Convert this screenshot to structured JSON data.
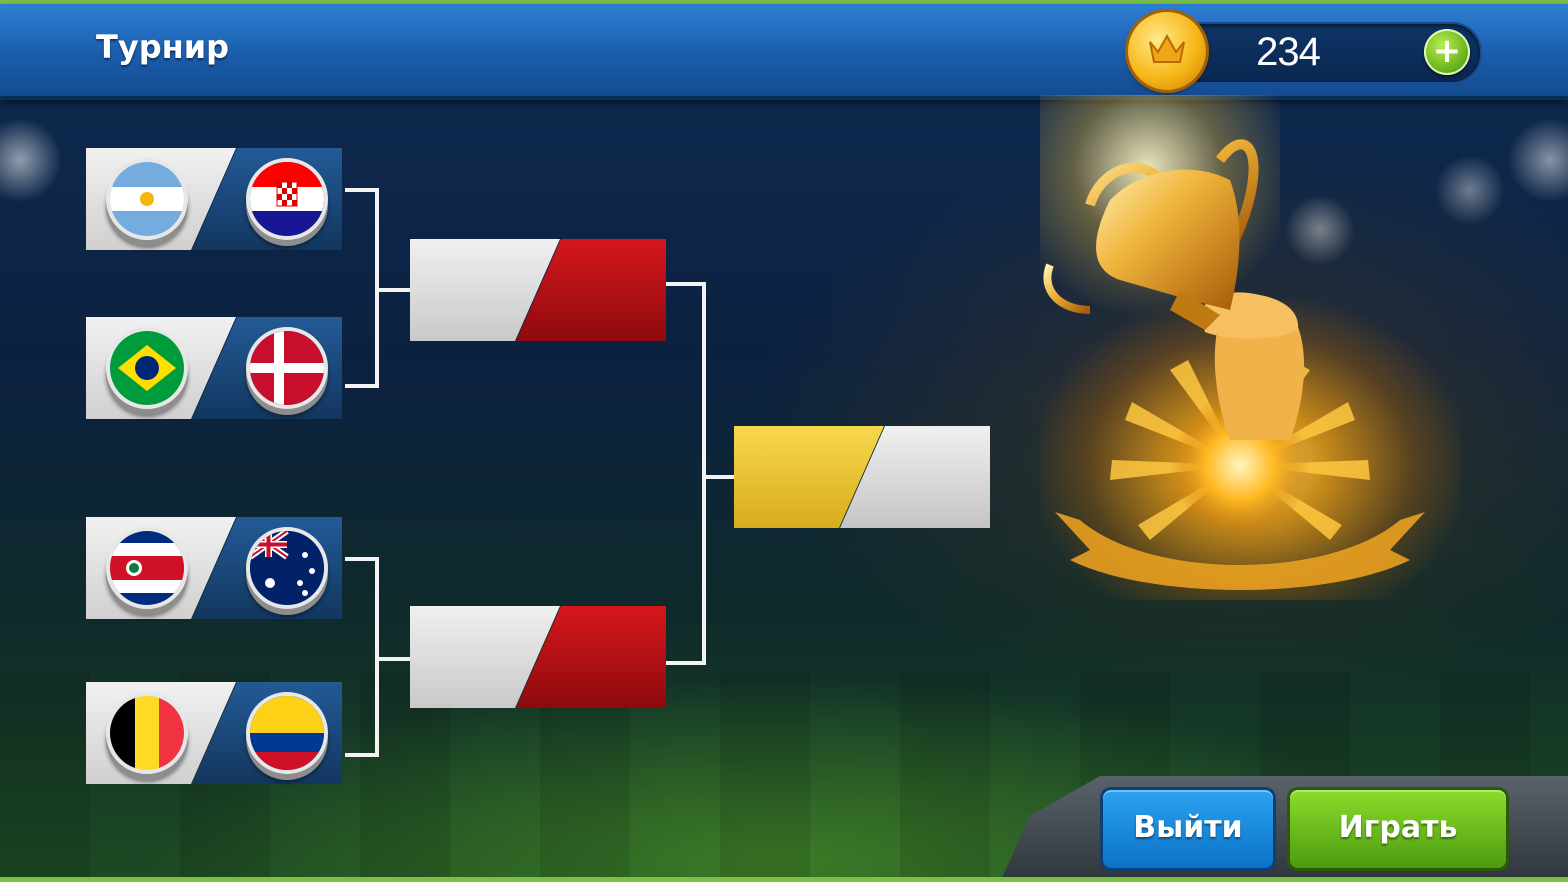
{
  "header": {
    "title": "Турнир",
    "coins": "234",
    "add_coins_icon": "plus-icon",
    "coin_icon": "crown-coin-icon"
  },
  "bracket": {
    "round1": [
      {
        "team1": "argentina-flag",
        "team2": "croatia-flag"
      },
      {
        "team1": "brazil-flag",
        "team2": "denmark-flag"
      },
      {
        "team1": "costa-rica-flag",
        "team2": "australia-flag"
      },
      {
        "team1": "belgium-flag",
        "team2": "colombia-flag"
      }
    ],
    "semifinals": [
      {
        "team1": "",
        "team2": ""
      },
      {
        "team1": "",
        "team2": ""
      }
    ],
    "final": {
      "team1": "",
      "team2": ""
    }
  },
  "decor": {
    "trophy_icon": "trophy-icon"
  },
  "buttons": {
    "exit": "Выйти",
    "play": "Играть"
  },
  "colors": {
    "exit_button": "#0c72c8",
    "play_button": "#4d9c0f",
    "header": "#1a5cab",
    "semifinal_right": "#d5171c",
    "final_left": "#f7d84d"
  }
}
